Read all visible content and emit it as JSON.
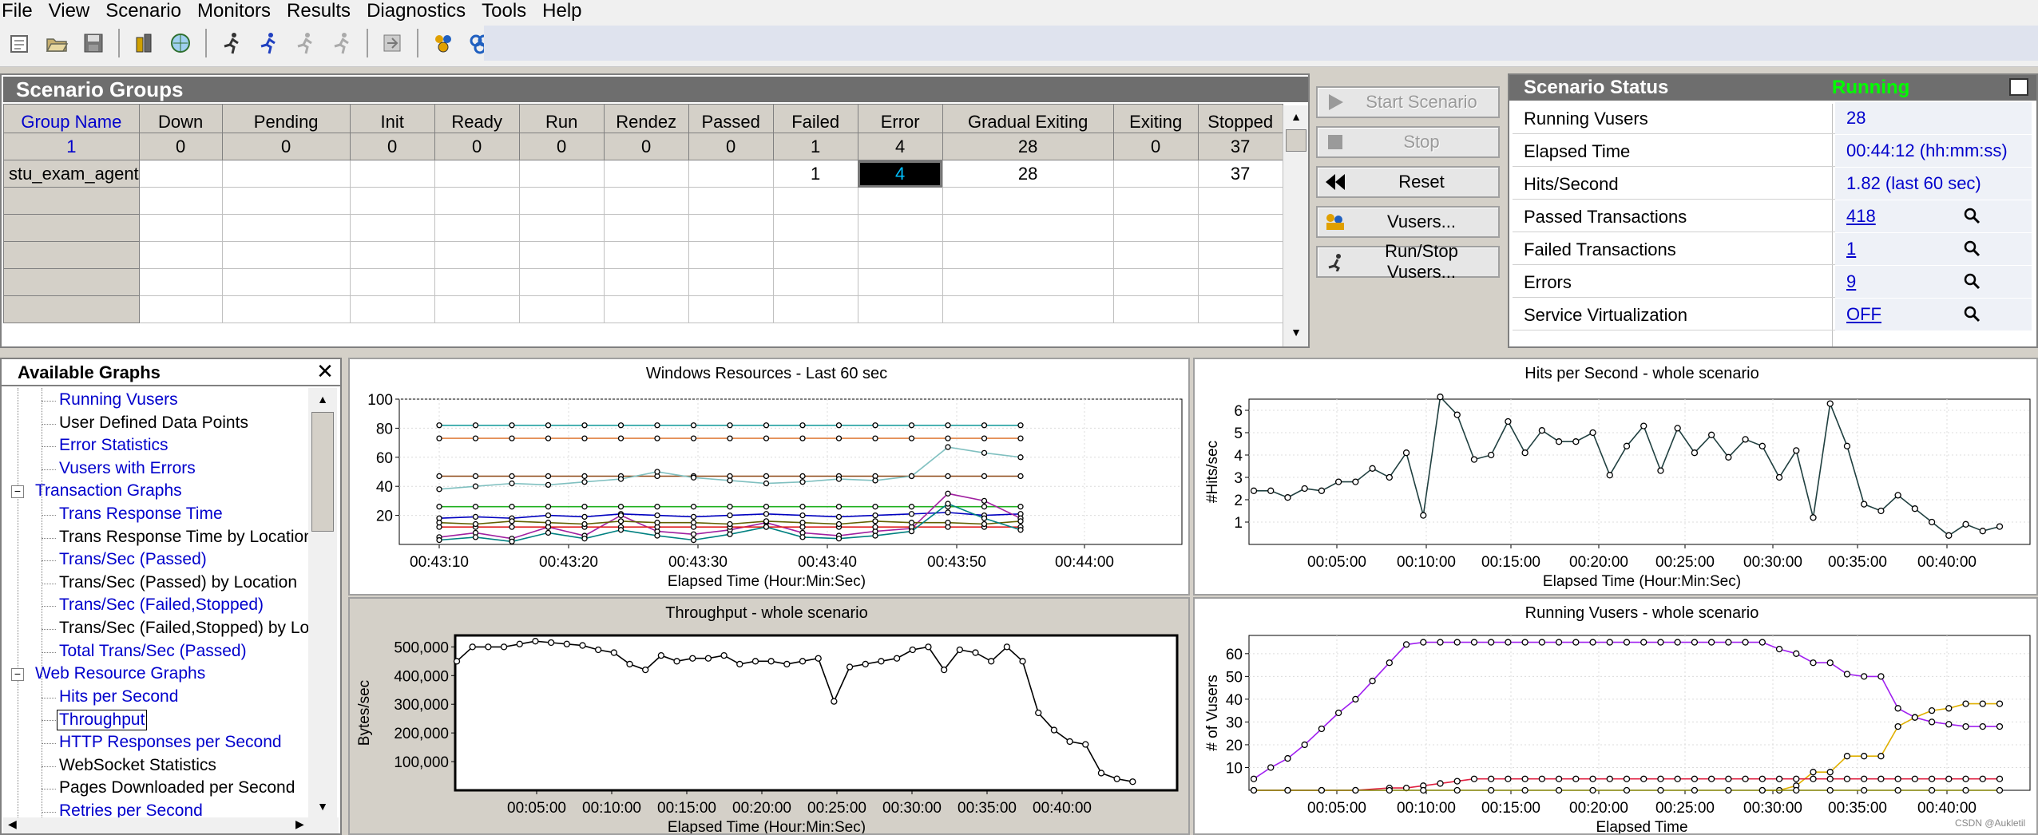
{
  "menu": [
    "File",
    "View",
    "Scenario",
    "Monitors",
    "Results",
    "Diagnostics",
    "Tools",
    "Help"
  ],
  "toolbar_icons": [
    "new-scenario-icon",
    "open-icon",
    "save-icon",
    "load-generators-icon",
    "network-icon",
    "run-icon",
    "runner-icon",
    "runner-disabled-icon",
    "runner-stop-icon",
    "export-icon",
    "people-icon",
    "analysis-icon"
  ],
  "scenario_groups": {
    "title": "Scenario Groups",
    "headers": [
      "Group Name",
      "Down",
      "Pending",
      "Init",
      "Ready",
      "Run",
      "Rendez",
      "Passed",
      "Failed",
      "Error",
      "Gradual Exiting",
      "Exiting",
      "Stopped"
    ],
    "totals": [
      "1",
      "0",
      "0",
      "0",
      "0",
      "0",
      "0",
      "0",
      "1",
      "4",
      "28",
      "0",
      "37"
    ],
    "rows": [
      [
        "stu_exam_agent",
        "",
        "",
        "",
        "",
        "",
        "",
        "",
        "1",
        "4",
        "28",
        "",
        "37"
      ]
    ]
  },
  "controls": {
    "start": "Start Scenario",
    "stop": "Stop",
    "reset": "Reset",
    "vusers": "Vusers...",
    "run_stop": "Run/Stop Vusers..."
  },
  "scenario_status": {
    "title": "Scenario Status",
    "state": "Running",
    "state_color": "#00ff00",
    "rows": [
      {
        "label": "Running Vusers",
        "value": "28"
      },
      {
        "label": "Elapsed Time",
        "value": "00:44:12 (hh:mm:ss)"
      },
      {
        "label": "Hits/Second",
        "value": "1.82 (last 60 sec)"
      },
      {
        "label": "Passed Transactions",
        "value": "418"
      },
      {
        "label": "Failed Transactions",
        "value": "1"
      },
      {
        "label": "Errors",
        "value": "9"
      },
      {
        "label": "Service Virtualization",
        "value": "OFF"
      }
    ]
  },
  "available_graphs": {
    "title": "Available Graphs",
    "items": [
      {
        "label": "Running Vusers",
        "level": 2,
        "blue": true
      },
      {
        "label": "User Defined Data Points",
        "level": 2,
        "blue": false
      },
      {
        "label": "Error Statistics",
        "level": 2,
        "blue": true
      },
      {
        "label": "Vusers with Errors",
        "level": 2,
        "blue": true
      },
      {
        "label": "Transaction Graphs",
        "level": 1,
        "blue": true
      },
      {
        "label": "Trans Response Time",
        "level": 2,
        "blue": true
      },
      {
        "label": "Trans Response Time by Location",
        "level": 2,
        "blue": false
      },
      {
        "label": "Trans/Sec (Passed)",
        "level": 2,
        "blue": true
      },
      {
        "label": "Trans/Sec (Passed) by Location",
        "level": 2,
        "blue": false
      },
      {
        "label": "Trans/Sec (Failed,Stopped)",
        "level": 2,
        "blue": true
      },
      {
        "label": "Trans/Sec (Failed,Stopped) by Lo",
        "level": 2,
        "blue": false
      },
      {
        "label": "Total Trans/Sec (Passed)",
        "level": 2,
        "blue": true
      },
      {
        "label": "Web Resource Graphs",
        "level": 1,
        "blue": true
      },
      {
        "label": "Hits per Second",
        "level": 2,
        "blue": true
      },
      {
        "label": "Throughput",
        "level": 2,
        "blue": true
      },
      {
        "label": "HTTP Responses per Second",
        "level": 2,
        "blue": true
      },
      {
        "label": "WebSocket Statistics",
        "level": 2,
        "blue": false
      },
      {
        "label": "Pages Downloaded per Second",
        "level": 2,
        "blue": false
      },
      {
        "label": "Retries per Second",
        "level": 2,
        "blue": true
      }
    ]
  },
  "chart_data": [
    {
      "type": "line",
      "title": "Windows Resources - Last 60 sec",
      "xlabel": "Elapsed Time (Hour:Min:Sec)",
      "ylabel": "",
      "xticks": [
        "00:43:10",
        "00:43:20",
        "00:43:30",
        "00:43:40",
        "00:43:50",
        "00:44:00"
      ],
      "yticks": [
        20,
        40,
        60,
        80,
        100
      ],
      "ylim": [
        0,
        100
      ],
      "x": [
        0,
        3,
        6,
        9,
        12,
        15,
        18,
        21,
        24,
        27,
        30,
        33,
        36,
        39,
        42,
        45,
        48
      ],
      "series": [
        {
          "color": "#20a0a0",
          "values": [
            82,
            82,
            82,
            82,
            82,
            82,
            82,
            82,
            82,
            82,
            82,
            82,
            82,
            82,
            82,
            82,
            82
          ]
        },
        {
          "color": "#e08040",
          "values": [
            73,
            73,
            73,
            73,
            73,
            73,
            73,
            73,
            73,
            73,
            73,
            73,
            73,
            73,
            73,
            73,
            73
          ]
        },
        {
          "color": "#8b4513",
          "values": [
            47,
            47,
            47,
            47,
            47,
            47,
            47,
            47,
            47,
            47,
            47,
            47,
            47,
            47,
            47,
            47,
            47
          ]
        },
        {
          "color": "#80c0c0",
          "values": [
            38,
            40,
            42,
            41,
            43,
            45,
            50,
            46,
            44,
            42,
            43,
            45,
            44,
            47,
            67,
            63,
            60
          ]
        },
        {
          "color": "#20b020",
          "values": [
            26,
            26,
            26,
            26,
            26,
            26,
            26,
            26,
            26,
            26,
            26,
            26,
            26,
            26,
            26,
            26,
            26
          ]
        },
        {
          "color": "#0000c0",
          "values": [
            18,
            19,
            18,
            20,
            19,
            21,
            20,
            19,
            20,
            21,
            20,
            19,
            20,
            21,
            22,
            20,
            21
          ]
        },
        {
          "color": "#a020a0",
          "values": [
            5,
            8,
            4,
            12,
            6,
            20,
            9,
            7,
            10,
            15,
            8,
            6,
            9,
            11,
            35,
            30,
            18
          ]
        },
        {
          "color": "#e02020",
          "values": [
            12,
            12,
            12,
            12,
            12,
            12,
            12,
            12,
            12,
            12,
            12,
            12,
            12,
            12,
            12,
            12,
            12
          ]
        },
        {
          "color": "#606000",
          "values": [
            15,
            14,
            16,
            15,
            14,
            16,
            15,
            15,
            14,
            16,
            15,
            14,
            16,
            15,
            15,
            14,
            16
          ]
        },
        {
          "color": "#008080",
          "values": [
            3,
            5,
            2,
            8,
            4,
            10,
            6,
            3,
            7,
            12,
            5,
            4,
            6,
            9,
            28,
            18,
            10
          ]
        }
      ]
    },
    {
      "type": "line",
      "title": "Hits per Second - whole scenario",
      "xlabel": "Elapsed Time (Hour:Min:Sec)",
      "ylabel": "#Hits/sec",
      "xticks": [
        "00:05:00",
        "00:10:00",
        "00:15:00",
        "00:20:00",
        "00:25:00",
        "00:30:00",
        "00:35:00",
        "00:40:00"
      ],
      "yticks": [
        1,
        2,
        3,
        4,
        5,
        6
      ],
      "ylim": [
        0,
        6.5
      ],
      "xlim": [
        0,
        44
      ],
      "series": [
        {
          "color": "#204040",
          "x": [
            0,
            1,
            2,
            3,
            4,
            5,
            6,
            7,
            8,
            9,
            10,
            11,
            12,
            13,
            14,
            15,
            16,
            17,
            18,
            19,
            20,
            21,
            22,
            23,
            24,
            25,
            26,
            27,
            28,
            29,
            30,
            31,
            32,
            33,
            34,
            35,
            36,
            37,
            38,
            39,
            40,
            41,
            42,
            43,
            44
          ],
          "values": [
            2.4,
            2.4,
            2.1,
            2.5,
            2.4,
            2.8,
            2.8,
            3.4,
            3.0,
            4.1,
            1.3,
            6.6,
            5.8,
            3.8,
            4.0,
            5.5,
            4.1,
            5.1,
            4.6,
            4.6,
            5.0,
            3.1,
            4.4,
            5.3,
            3.3,
            5.2,
            4.1,
            4.9,
            3.9,
            4.7,
            4.4,
            3.0,
            4.2,
            1.2,
            6.3,
            4.4,
            1.8,
            1.5,
            2.2,
            1.6,
            1.0,
            0.4,
            0.9,
            0.6,
            0.8
          ]
        }
      ]
    },
    {
      "type": "line",
      "title": "Throughput - whole scenario",
      "xlabel": "Elapsed Time (Hour:Min:Sec)",
      "ylabel": "Bytes/sec",
      "xticks": [
        "00:05:00",
        "00:10:00",
        "00:15:00",
        "00:20:00",
        "00:25:00",
        "00:30:00",
        "00:35:00",
        "00:40:00"
      ],
      "yticks": [
        100000,
        200000,
        300000,
        400000,
        500000
      ],
      "ytick_labels": [
        "100,000",
        "200,000",
        "300,000",
        "400,000",
        "500,000"
      ],
      "ylim": [
        0,
        540000
      ],
      "xlim": [
        0,
        44
      ],
      "series": [
        {
          "color": "#000000",
          "x": [
            0,
            1,
            2,
            3,
            4,
            5,
            6,
            7,
            8,
            9,
            10,
            11,
            12,
            13,
            14,
            15,
            16,
            17,
            18,
            19,
            20,
            21,
            22,
            23,
            24,
            25,
            26,
            27,
            28,
            29,
            30,
            31,
            32,
            33,
            34,
            35,
            36,
            37,
            38,
            39,
            40,
            41,
            42,
            43
          ],
          "values": [
            450000,
            500000,
            500000,
            500000,
            510000,
            520000,
            515000,
            510000,
            505000,
            490000,
            480000,
            440000,
            420000,
            470000,
            450000,
            460000,
            460000,
            470000,
            440000,
            450000,
            450000,
            440000,
            450000,
            460000,
            310000,
            430000,
            440000,
            450000,
            460000,
            490000,
            500000,
            420000,
            490000,
            480000,
            450000,
            500000,
            450000,
            270000,
            210000,
            170000,
            160000,
            60000,
            40000,
            30000
          ]
        }
      ]
    },
    {
      "type": "line",
      "title": "Running Vusers - whole scenario",
      "xlabel": "Elapsed Time",
      "ylabel": "# of Vusers",
      "xticks": [
        "00:05:00",
        "00:10:00",
        "00:15:00",
        "00:20:00",
        "00:25:00",
        "00:30:00",
        "00:35:00",
        "00:40:00"
      ],
      "yticks": [
        10,
        20,
        30,
        40,
        50,
        60
      ],
      "ylim": [
        0,
        68
      ],
      "xlim": [
        0,
        44
      ],
      "series": [
        {
          "color": "#a020f0",
          "x": [
            0,
            1,
            2,
            3,
            4,
            5,
            6,
            7,
            8,
            9,
            10,
            11,
            12,
            13,
            14,
            15,
            16,
            17,
            18,
            19,
            20,
            21,
            22,
            23,
            24,
            25,
            26,
            27,
            28,
            29,
            30,
            31,
            32,
            33,
            34,
            35,
            36,
            37,
            38,
            39,
            40,
            41,
            42,
            43,
            44
          ],
          "values": [
            5,
            10,
            14,
            20,
            27,
            34,
            40,
            48,
            56,
            64,
            65,
            65,
            65,
            65,
            65,
            65,
            65,
            65,
            65,
            65,
            65,
            65,
            65,
            65,
            65,
            65,
            65,
            65,
            65,
            65,
            65,
            62,
            60,
            56,
            56,
            51,
            50,
            50,
            36,
            32,
            30,
            29,
            28,
            28,
            28
          ]
        },
        {
          "color": "#e0b000",
          "x": [
            30,
            31,
            32,
            33,
            34,
            35,
            36,
            37,
            38,
            39,
            40,
            41,
            42,
            43,
            44
          ],
          "values": [
            0,
            0,
            2,
            8,
            8,
            15,
            15,
            15,
            28,
            32,
            35,
            36,
            38,
            38,
            38
          ]
        },
        {
          "color": "#e02040",
          "x": [
            0,
            2,
            4,
            6,
            8,
            9,
            10,
            11,
            12,
            13,
            14,
            15,
            16,
            17,
            18,
            19,
            20,
            21,
            22,
            23,
            24,
            25,
            26,
            27,
            28,
            29,
            30,
            31,
            32,
            33,
            34,
            35,
            36,
            37,
            38,
            39,
            40,
            41,
            42,
            43,
            44
          ],
          "values": [
            0,
            0,
            0,
            0,
            1,
            1,
            2,
            3,
            4,
            5,
            5,
            5,
            5,
            5,
            5,
            5,
            5,
            5,
            5,
            5,
            5,
            5,
            5,
            5,
            5,
            5,
            5,
            5,
            5,
            5,
            5,
            5,
            5,
            5,
            5,
            5,
            5,
            5,
            5,
            5,
            5
          ]
        },
        {
          "color": "#808000",
          "x": [
            0,
            2,
            4,
            6,
            8,
            10,
            12,
            14,
            16,
            18,
            20,
            22,
            24,
            26,
            28,
            30,
            32,
            34,
            36,
            38,
            40,
            42,
            44
          ],
          "values": [
            0,
            0,
            0,
            0,
            0,
            0,
            0,
            0,
            0,
            0,
            0,
            0,
            0,
            0,
            0,
            0,
            0,
            0,
            0,
            0,
            0,
            0,
            0
          ]
        }
      ]
    }
  ],
  "watermark": "CSDN @Aukletil"
}
